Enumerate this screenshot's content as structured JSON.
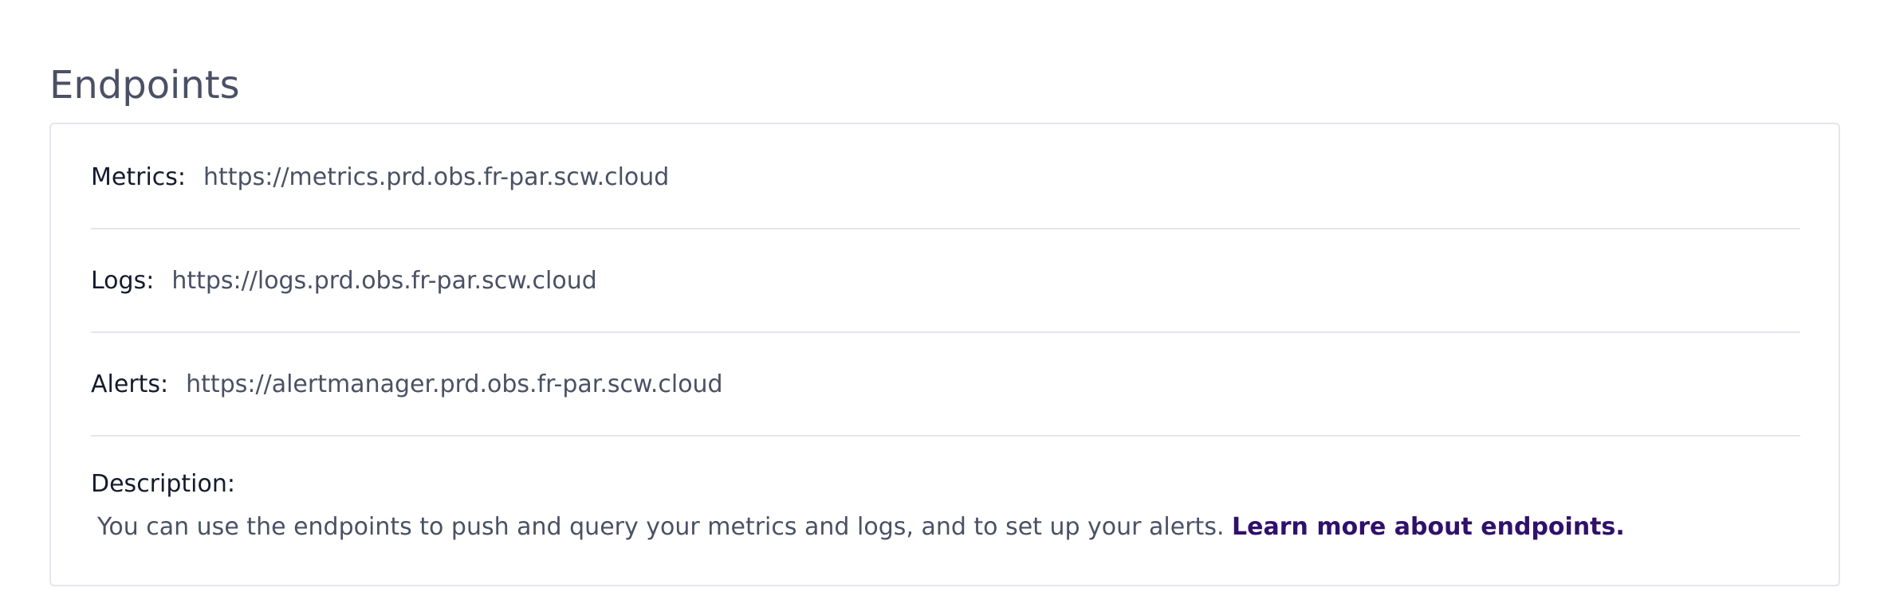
{
  "section": {
    "title": "Endpoints"
  },
  "endpoints": {
    "metrics": {
      "label": "Metrics:",
      "value": "https://metrics.prd.obs.fr-par.scw.cloud"
    },
    "logs": {
      "label": "Logs:",
      "value": "https://logs.prd.obs.fr-par.scw.cloud"
    },
    "alerts": {
      "label": "Alerts:",
      "value": "https://alertmanager.prd.obs.fr-par.scw.cloud"
    }
  },
  "description": {
    "label": "Description:",
    "text": "You can use the endpoints to push and query your metrics and logs, and to set up your alerts.",
    "link_label": "Learn more about endpoints."
  },
  "colors": {
    "title": "#4b5064",
    "label": "#151a2d",
    "value": "#4b5064",
    "link": "#30106b",
    "border": "#e5e6ec"
  }
}
